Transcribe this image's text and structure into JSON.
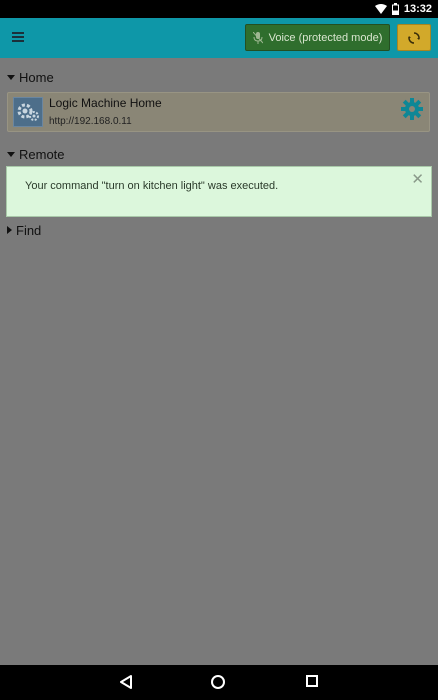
{
  "status_bar": {
    "time": "13:32"
  },
  "toolbar": {
    "voice_label": "Voice (protected mode)",
    "voice_color": "#2f6e2d",
    "sync_color": "#d2a92a",
    "accent": "#0e97a8"
  },
  "sections": {
    "home": {
      "label": "Home",
      "expanded": true
    },
    "remote": {
      "label": "Remote",
      "expanded": true
    },
    "find": {
      "label": "Find",
      "expanded": false
    }
  },
  "device": {
    "title": "Logic Machine Home",
    "url": "http://192.168.0.11",
    "logo_icon": "gears-icon",
    "settings_icon": "gear-icon"
  },
  "toast": {
    "message": "Your command \"turn on kitchen light\" was executed.",
    "close_icon": "close-icon"
  }
}
